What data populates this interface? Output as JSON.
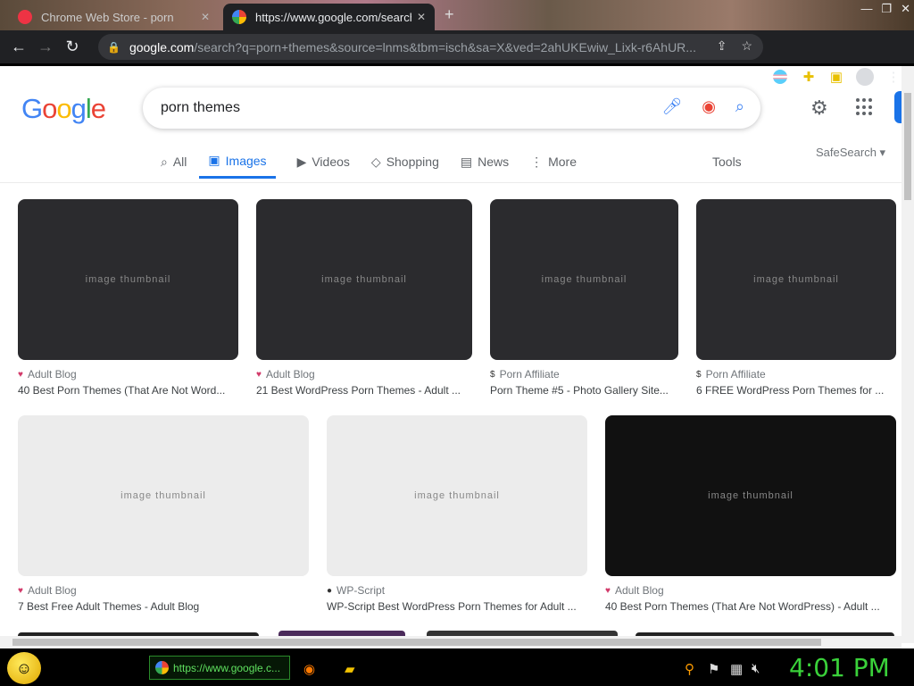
{
  "browser": {
    "tabs": [
      {
        "title": "Chrome Web Store - porn",
        "active": false
      },
      {
        "title": "https://www.google.com/search?",
        "active": true
      }
    ],
    "new_tab": "+",
    "window_controls": [
      "—",
      "❐",
      "✕"
    ],
    "url_domain": "google.com",
    "url_rest": "/search?q=porn+themes&source=lnms&tbm=isch&sa=X&ved=2ahUKEwiw_Lixk-r6AhUR..."
  },
  "google": {
    "logo": "Google",
    "logo_colors": [
      "#4285F4",
      "#EA4335",
      "#FBBC05",
      "#4285F4",
      "#34A853",
      "#EA4335"
    ],
    "query": "porn themes",
    "tabs": [
      {
        "label": "All",
        "icon": "search-icon"
      },
      {
        "label": "Images",
        "icon": "image-icon",
        "selected": true
      },
      {
        "label": "Videos",
        "icon": "video-icon"
      },
      {
        "label": "Shopping",
        "icon": "tag-icon"
      },
      {
        "label": "News",
        "icon": "news-icon"
      },
      {
        "label": "More",
        "icon": "more-icon"
      }
    ],
    "tools": "Tools",
    "safesearch": "SafeSearch ▾"
  },
  "results": [
    {
      "source": "Adult Blog",
      "title": "40 Best Porn Themes (That Are Not Word..."
    },
    {
      "source": "Adult Blog",
      "title": "21 Best WordPress Porn Themes - Adult ..."
    },
    {
      "source": "Porn Affiliate",
      "title": "Porn Theme #5 - Photo Gallery Site..."
    },
    {
      "source": "Porn Affiliate",
      "title": "6 FREE WordPress Porn Themes for ..."
    },
    {
      "source": "Adult Blog",
      "title": "7 Best Free Adult Themes - Adult Blog"
    },
    {
      "source": "WP-Script",
      "title": "WP-Script Best WordPress Porn Themes for Adult ..."
    },
    {
      "source": "Adult Blog",
      "title": "40 Best Porn Themes (That Are Not WordPress) - Adult ..."
    }
  ],
  "thumbnail_placeholder": "image thumbnail",
  "taskbar": {
    "item": "https://www.google.c...",
    "clock": "4:01 PM"
  }
}
